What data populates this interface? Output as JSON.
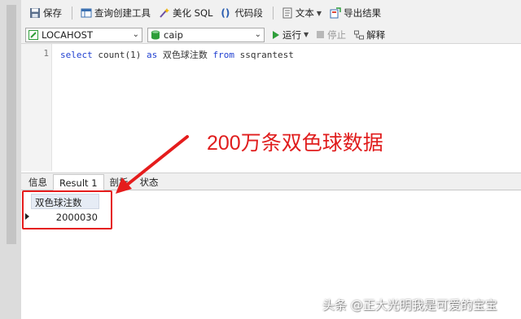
{
  "toolbar": {
    "save_label": "保存",
    "query_builder_label": "查询创建工具",
    "beautify_label": "美化 SQL",
    "snippet_label": "代码段",
    "text_label": "文本",
    "export_label": "导出结果"
  },
  "connection": {
    "host": "LOCAHOST",
    "database": "caip"
  },
  "actions": {
    "run_label": "运行",
    "stop_label": "停止",
    "explain_label": "解释"
  },
  "editor": {
    "line_number": "1",
    "sql": {
      "kw1": "select",
      "fn": "count(1)",
      "kw2": "as",
      "alias": "双色球注数",
      "kw3": "from",
      "table": "ssqrantest"
    }
  },
  "annotation": {
    "text": "200万条双色球数据",
    "color": "#e01d1d"
  },
  "tabs": [
    {
      "label": "信息"
    },
    {
      "label": "Result 1"
    },
    {
      "label": "剖析"
    },
    {
      "label": "状态"
    }
  ],
  "result": {
    "column": "双色球注数",
    "value": "2000030"
  },
  "watermark": "头条 @正大光明我是可爱的宝宝",
  "icons": [
    "save-icon",
    "query-builder-icon",
    "beautify-icon",
    "snippet-icon",
    "text-icon",
    "export-icon",
    "connection-icon",
    "database-icon",
    "run-icon",
    "stop-icon",
    "explain-icon",
    "row-indicator-icon"
  ]
}
